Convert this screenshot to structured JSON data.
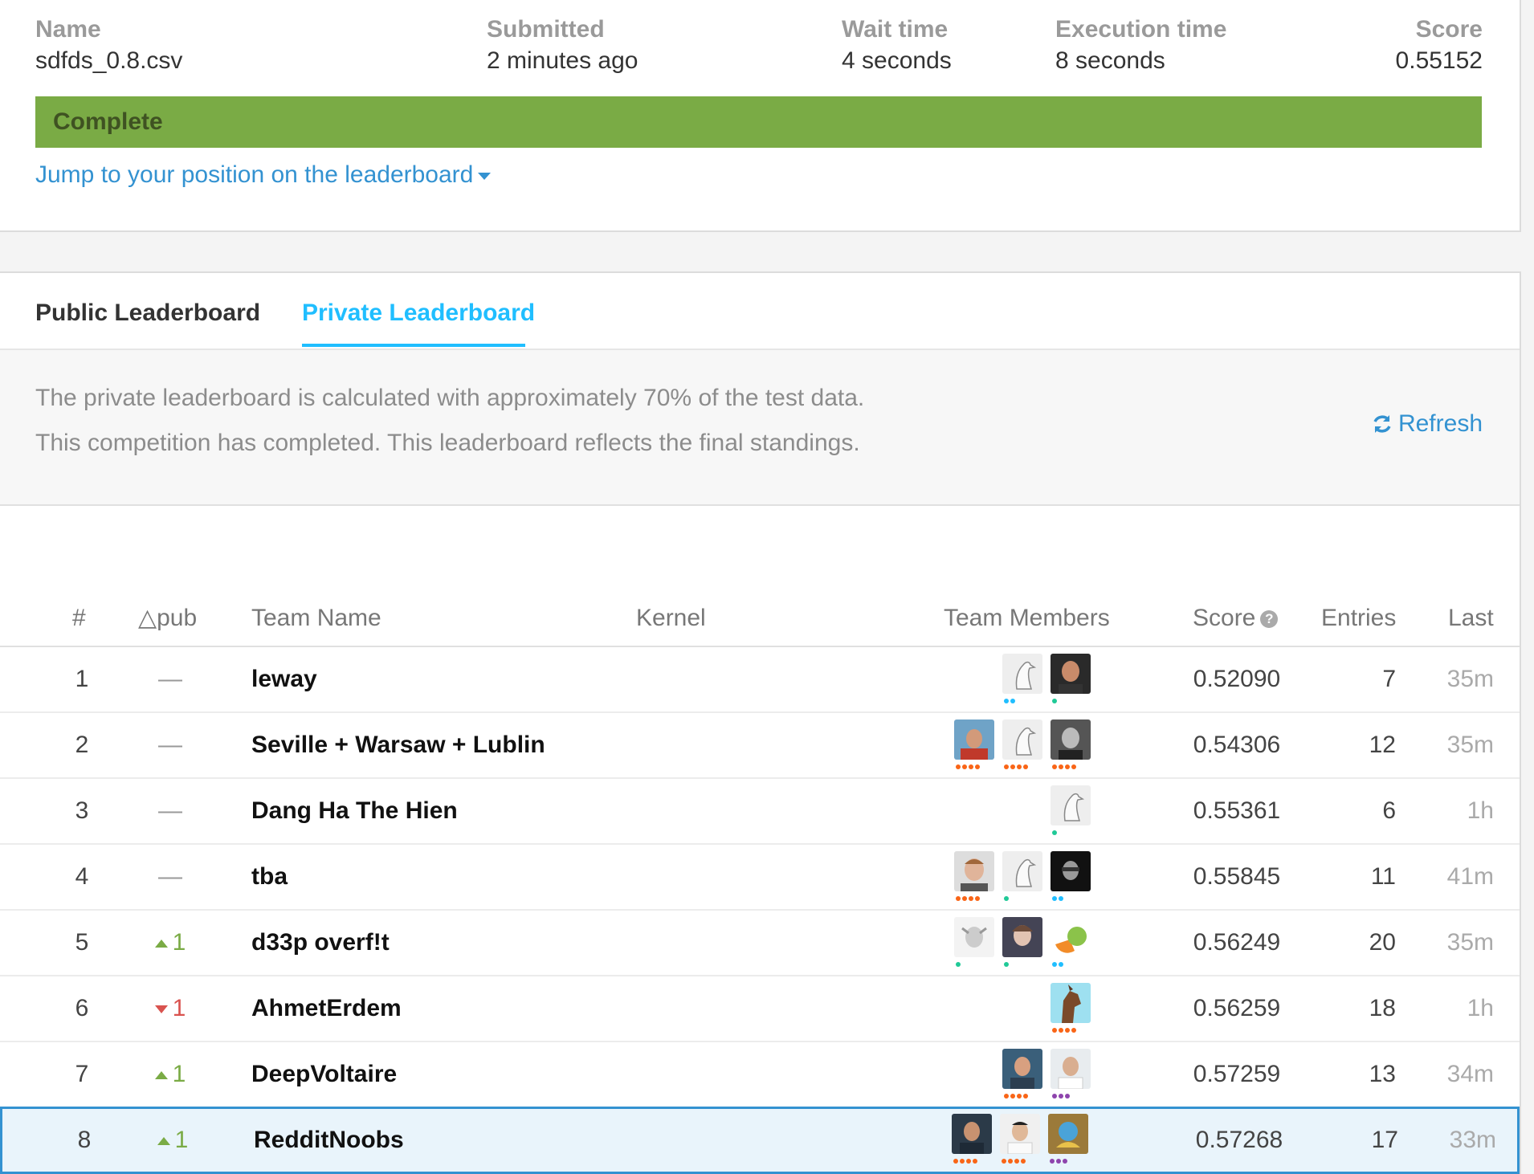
{
  "submission": {
    "name_label": "Name",
    "name_value": "sdfds_0.8.csv",
    "submitted_label": "Submitted",
    "submitted_value": "2 minutes ago",
    "wait_label": "Wait time",
    "wait_value": "4 seconds",
    "exec_label": "Execution time",
    "exec_value": "8 seconds",
    "score_label": "Score",
    "score_value": "0.55152",
    "status": "Complete",
    "jump_link": "Jump to your position on the leaderboard"
  },
  "tabs": {
    "public": "Public Leaderboard",
    "private": "Private Leaderboard"
  },
  "info": {
    "line1": "The private leaderboard is calculated with approximately 70% of the test data.",
    "line2": "This competition has completed. This leaderboard reflects the final standings.",
    "refresh": "Refresh"
  },
  "table": {
    "headers": {
      "rank": "#",
      "delta": "△pub",
      "team": "Team Name",
      "kernel": "Kernel",
      "members": "Team Members",
      "score": "Score",
      "entries": "Entries",
      "last": "Last"
    },
    "rows": [
      {
        "rank": "1",
        "delta": "—",
        "team": "leway",
        "score": "0.52090",
        "entries": "7",
        "last": "35m"
      },
      {
        "rank": "2",
        "delta": "—",
        "team": "Seville + Warsaw + Lublin",
        "score": "0.54306",
        "entries": "12",
        "last": "35m"
      },
      {
        "rank": "3",
        "delta": "—",
        "team": "Dang Ha The Hien",
        "score": "0.55361",
        "entries": "6",
        "last": "1h"
      },
      {
        "rank": "4",
        "delta": "—",
        "team": "tba",
        "score": "0.55845",
        "entries": "11",
        "last": "41m"
      },
      {
        "rank": "5",
        "delta": "1",
        "team": "d33p overf!t",
        "score": "0.56249",
        "entries": "20",
        "last": "35m"
      },
      {
        "rank": "6",
        "delta": "1",
        "team": "AhmetErdem",
        "score": "0.56259",
        "entries": "18",
        "last": "1h"
      },
      {
        "rank": "7",
        "delta": "1",
        "team": "DeepVoltaire",
        "score": "0.57259",
        "entries": "13",
        "last": "34m"
      },
      {
        "rank": "8",
        "delta": "1",
        "team": "RedditNoobs",
        "score": "0.57268",
        "entries": "17",
        "last": "33m"
      }
    ]
  },
  "colors": {
    "status_green": "#7aab45",
    "link_blue": "#3392d1",
    "tab_active": "#20beff",
    "up": "#7aab45",
    "down": "#d9534f"
  }
}
